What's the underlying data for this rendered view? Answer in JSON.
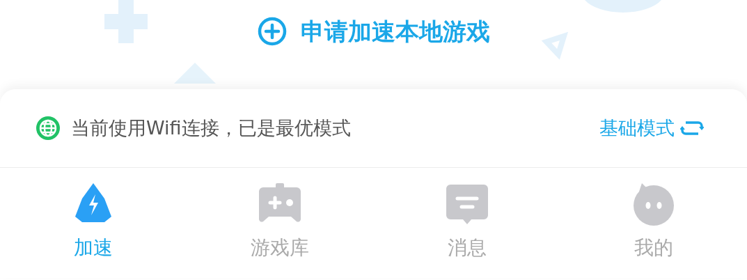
{
  "apply_button": {
    "label": "申请加速本地游戏"
  },
  "connection_status": {
    "text": "当前使用Wifi连接，已是最优模式",
    "mode_label": "基础模式"
  },
  "tabs": [
    {
      "label": "加速",
      "kind": "boost",
      "selected": true
    },
    {
      "label": "游戏库",
      "kind": "games",
      "selected": false
    },
    {
      "label": "消息",
      "kind": "messages",
      "selected": false
    },
    {
      "label": "我的",
      "kind": "profile",
      "selected": false
    }
  ]
}
